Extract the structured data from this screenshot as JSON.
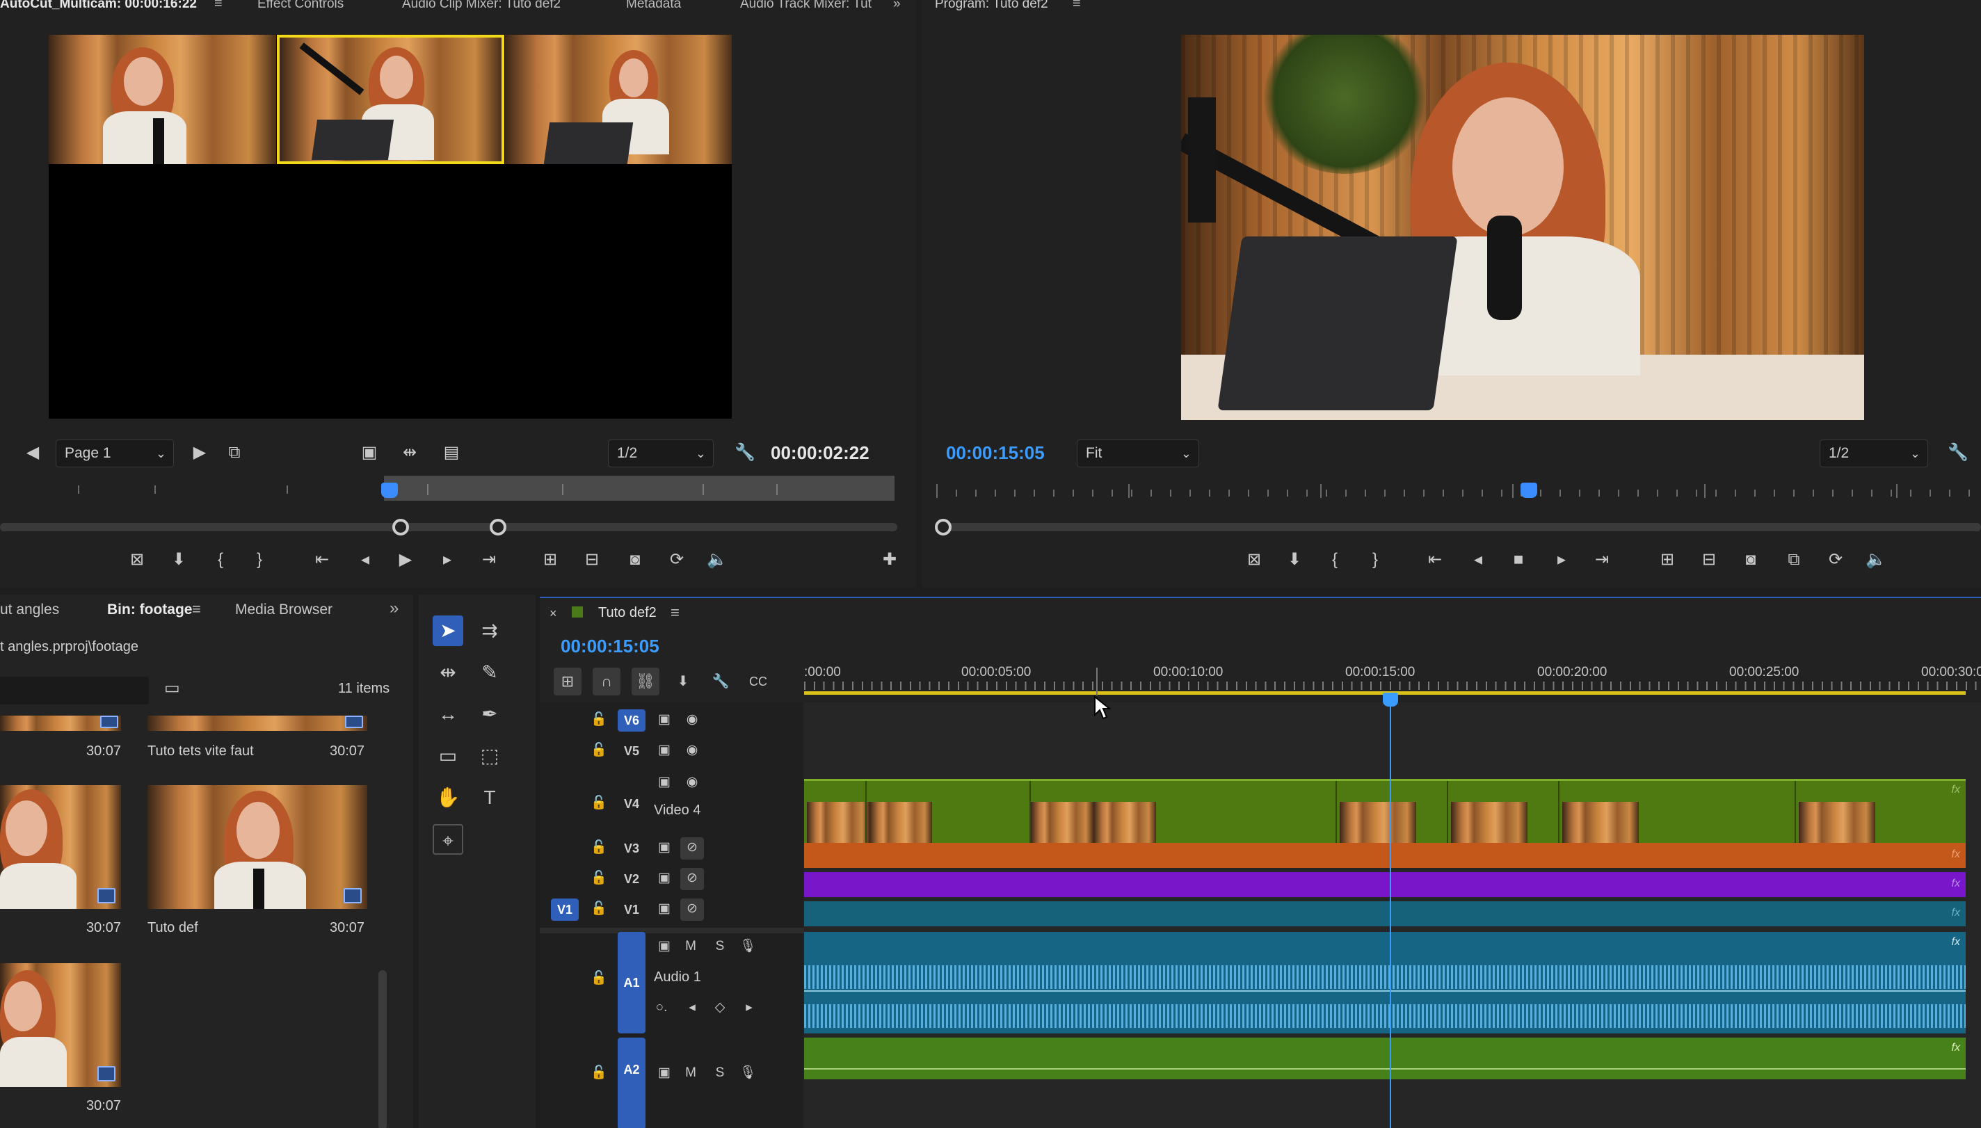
{
  "source_monitor": {
    "tabs": [
      "AutoCut_Multicam: 00:00:16:22",
      "Effect Controls",
      "Audio Clip Mixer: Tuto def2",
      "Metadata",
      "Audio Track Mixer: Tut"
    ],
    "more_icon": "»",
    "page_select": "Page 1",
    "resolution": "1/2",
    "timecode": "00:00:02:22"
  },
  "program_monitor": {
    "title": "Program: Tuto def2",
    "timecode": "00:00:15:05",
    "zoom": "Fit",
    "resolution": "1/2"
  },
  "project_panel": {
    "tabs": [
      "ut angles",
      "Bin: footage",
      "Media Browser"
    ],
    "path": "t angles.prproj\\footage",
    "item_count": "11 items",
    "items": [
      {
        "name": "",
        "duration": "30:07"
      },
      {
        "name": "Tuto tets vite faut",
        "duration": "30:07"
      },
      {
        "name": "",
        "duration": "30:07"
      },
      {
        "name": "Tuto def",
        "duration": "30:07"
      },
      {
        "name": "",
        "duration": "30:07"
      }
    ]
  },
  "timeline": {
    "sequence_name": "Tuto def2",
    "timecode": "00:00:15:05",
    "ruler_labels": [
      ":00:00",
      "00:00:05:00",
      "00:00:10:00",
      "00:00:15:00",
      "00:00:20:00",
      "00:00:25:00",
      "00:00:30:00"
    ],
    "video_tracks": [
      {
        "id": "V6",
        "label": ""
      },
      {
        "id": "V5",
        "label": ""
      },
      {
        "id": "V4",
        "label": "Video 4"
      },
      {
        "id": "V3",
        "label": ""
      },
      {
        "id": "V2",
        "label": ""
      },
      {
        "id": "V1",
        "label": ""
      }
    ],
    "source_target": "V1",
    "audio_tracks": [
      {
        "id": "A1",
        "label": "Audio 1",
        "m": "M",
        "s": "S"
      },
      {
        "id": "A2",
        "label": "",
        "m": "M",
        "s": "S"
      }
    ],
    "fx_label": "fx",
    "clip_colors": {
      "v4": "#4f7a12",
      "v3": "#c3581a",
      "v2": "#7a16c9",
      "v1": "#15627a",
      "a1": "#166584",
      "a2": "#46811a"
    }
  },
  "accent": "#2f5fb8",
  "timecode_color": "#3b9cff"
}
